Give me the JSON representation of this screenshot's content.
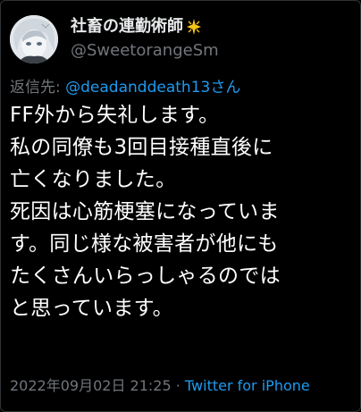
{
  "author": {
    "display_name": "社畜の連勤術師",
    "handle": "@SweetorangeSm",
    "name_emoji": "sparkle-icon"
  },
  "reply_context": {
    "prefix": "返信先:",
    "mention": "@deadanddeath13さん"
  },
  "tweet_lines": [
    "FF外から失礼します。",
    "私の同僚も3回目接種直後に",
    "亡くなりました。",
    "死因は心筋梗塞になっていま",
    "す。同じ様な被害者が他にも",
    "たくさんいらっしゃるのでは",
    "と思っています。"
  ],
  "meta": {
    "timestamp": "2022年09月02日 21:25",
    "separator": "·",
    "source": "Twitter for iPhone"
  },
  "colors": {
    "background": "#000000",
    "text": "#ffffff",
    "secondary": "#71767b",
    "link": "#1d9bf0"
  }
}
